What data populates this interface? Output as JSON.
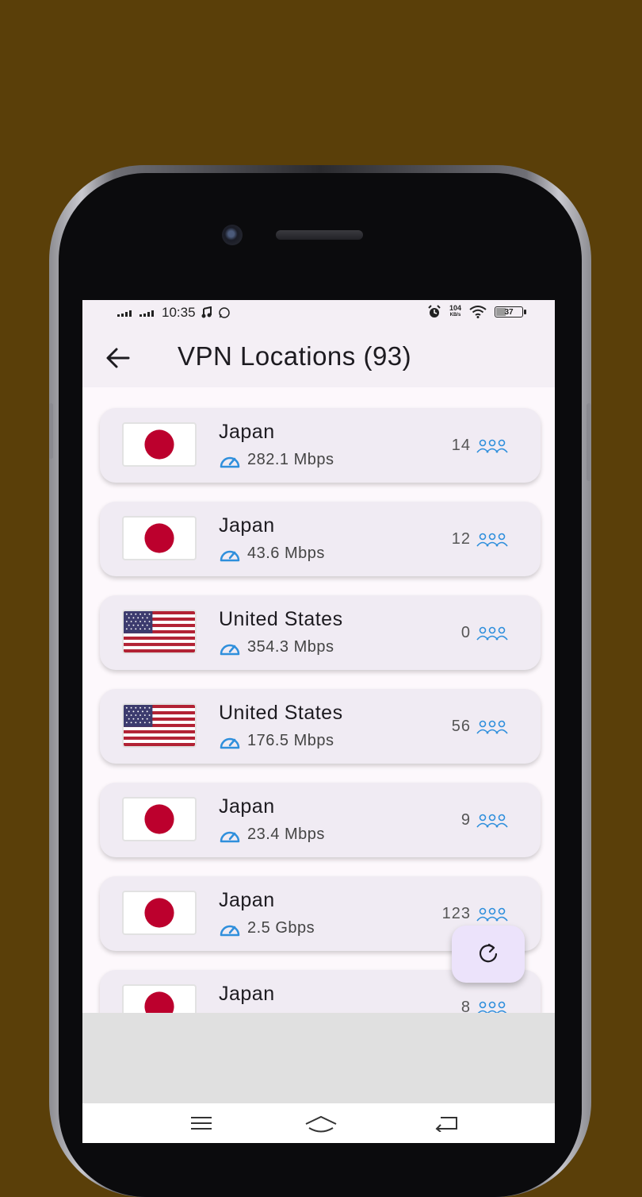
{
  "status_bar": {
    "time": "10:35",
    "network_speed_value": "104",
    "network_speed_unit": "KB/s",
    "battery": "37",
    "icons": [
      "signal-icon",
      "music-icon",
      "whatsapp-icon",
      "alarm-icon",
      "wifi-icon",
      "battery-icon"
    ]
  },
  "app_bar": {
    "title": "VPN Locations (93)",
    "back_icon": "arrow-left-icon"
  },
  "servers": [
    {
      "country": "Japan",
      "flag": "japan",
      "speed": "282.1 Mbps",
      "users": "14"
    },
    {
      "country": "Japan",
      "flag": "japan",
      "speed": "43.6 Mbps",
      "users": "12"
    },
    {
      "country": "United States",
      "flag": "usa",
      "speed": "354.3 Mbps",
      "users": "0"
    },
    {
      "country": "United States",
      "flag": "usa",
      "speed": "176.5 Mbps",
      "users": "56"
    },
    {
      "country": "Japan",
      "flag": "japan",
      "speed": "23.4 Mbps",
      "users": "9"
    },
    {
      "country": "Japan",
      "flag": "japan",
      "speed": "2.5 Gbps",
      "users": "123"
    },
    {
      "country": "Japan",
      "flag": "japan",
      "speed": "",
      "users": "8"
    }
  ],
  "fab": {
    "icon": "refresh-icon"
  },
  "nav_bar": {
    "icons": [
      "menu-icon",
      "home-icon",
      "back-icon"
    ]
  },
  "colors": {
    "background": "#5a3f09",
    "card": "#f0ebf3",
    "accent_blue": "#2f8fdc",
    "fab": "#ece3fb",
    "japan_red": "#bc002d"
  }
}
